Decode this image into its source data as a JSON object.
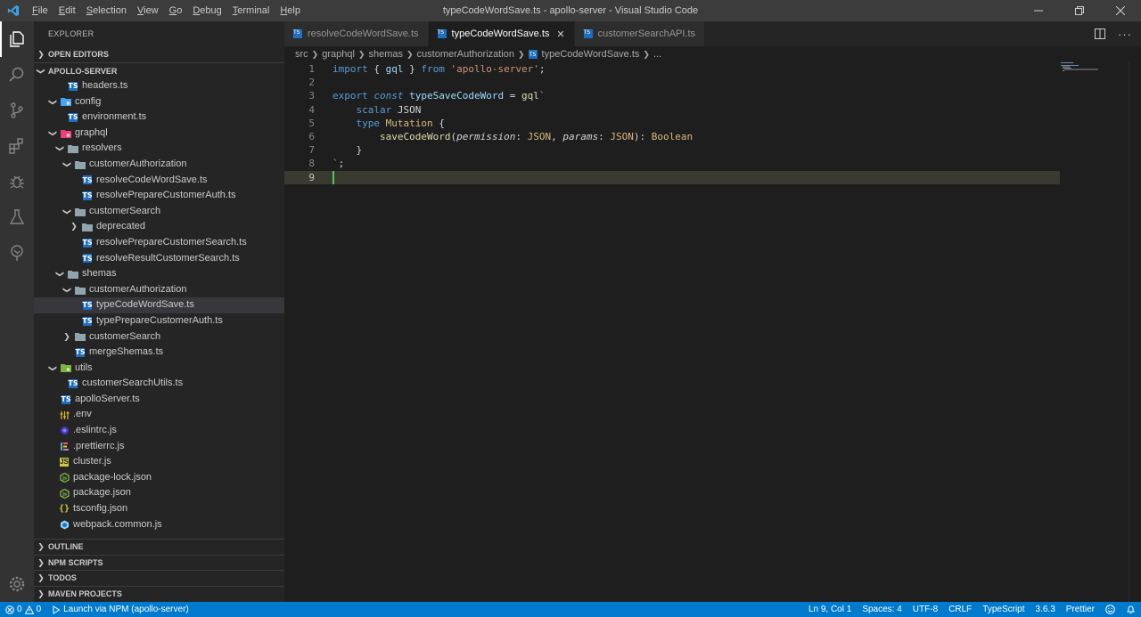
{
  "window": {
    "title": "typeCodeWordSave.ts - apollo-server - Visual Studio Code",
    "menu": [
      "File",
      "Edit",
      "Selection",
      "View",
      "Go",
      "Debug",
      "Terminal",
      "Help"
    ]
  },
  "sidebar": {
    "title": "EXPLORER",
    "sections_top": [
      "OPEN EDITORS",
      "APOLLO-SERVER"
    ],
    "tree": [
      {
        "label": "headers.ts",
        "depth": 2,
        "icon": "ts",
        "twisty": ""
      },
      {
        "label": "config",
        "depth": 1,
        "icon": "folder-config",
        "twisty": "open"
      },
      {
        "label": "environment.ts",
        "depth": 2,
        "icon": "ts",
        "twisty": ""
      },
      {
        "label": "graphql",
        "depth": 1,
        "icon": "folder-graphql",
        "twisty": "open"
      },
      {
        "label": "resolvers",
        "depth": 2,
        "icon": "folder",
        "twisty": "open"
      },
      {
        "label": "customerAuthorization",
        "depth": 3,
        "icon": "folder",
        "twisty": "open"
      },
      {
        "label": "resolveCodeWordSave.ts",
        "depth": 4,
        "icon": "ts",
        "twisty": ""
      },
      {
        "label": "resolvePrepareCustomerAuth.ts",
        "depth": 4,
        "icon": "ts",
        "twisty": ""
      },
      {
        "label": "customerSearch",
        "depth": 3,
        "icon": "folder",
        "twisty": "open"
      },
      {
        "label": "deprecated",
        "depth": 4,
        "icon": "folder",
        "twisty": "closed"
      },
      {
        "label": "resolvePrepareCustomerSearch.ts",
        "depth": 4,
        "icon": "ts",
        "twisty": ""
      },
      {
        "label": "resolveResultCustomerSearch.ts",
        "depth": 4,
        "icon": "ts",
        "twisty": ""
      },
      {
        "label": "shemas",
        "depth": 2,
        "icon": "folder",
        "twisty": "open"
      },
      {
        "label": "customerAuthorization",
        "depth": 3,
        "icon": "folder",
        "twisty": "open"
      },
      {
        "label": "typeCodeWordSave.ts",
        "depth": 4,
        "icon": "ts",
        "twisty": "",
        "selected": true
      },
      {
        "label": "typePrepareCustomerAuth.ts",
        "depth": 4,
        "icon": "ts",
        "twisty": ""
      },
      {
        "label": "customerSearch",
        "depth": 3,
        "icon": "folder",
        "twisty": "closed"
      },
      {
        "label": "mergeShemas.ts",
        "depth": 3,
        "icon": "ts",
        "twisty": ""
      },
      {
        "label": "utils",
        "depth": 1,
        "icon": "folder-utils",
        "twisty": "open"
      },
      {
        "label": "customerSearchUtils.ts",
        "depth": 2,
        "icon": "ts",
        "twisty": ""
      },
      {
        "label": "apolloServer.ts",
        "depth": 1,
        "icon": "ts",
        "twisty": ""
      },
      {
        "label": ".env",
        "depth": 0,
        "icon": "env",
        "twisty": ""
      },
      {
        "label": ".eslintrc.js",
        "depth": 0,
        "icon": "eslint",
        "twisty": ""
      },
      {
        "label": ".prettierrc.js",
        "depth": 0,
        "icon": "prettier",
        "twisty": ""
      },
      {
        "label": "cluster.js",
        "depth": 0,
        "icon": "js",
        "twisty": ""
      },
      {
        "label": "package-lock.json",
        "depth": 0,
        "icon": "npm",
        "twisty": ""
      },
      {
        "label": "package.json",
        "depth": 0,
        "icon": "npm",
        "twisty": ""
      },
      {
        "label": "tsconfig.json",
        "depth": 0,
        "icon": "json",
        "twisty": ""
      },
      {
        "label": "webpack.common.js",
        "depth": 0,
        "icon": "webpack",
        "twisty": ""
      }
    ],
    "sections_bottom": [
      "OUTLINE",
      "NPM SCRIPTS",
      "TODOS",
      "MAVEN PROJECTS"
    ]
  },
  "tabs": [
    {
      "label": "resolveCodeWordSave.ts",
      "active": false
    },
    {
      "label": "typeCodeWordSave.ts",
      "active": true
    },
    {
      "label": "customerSearchAPI.ts",
      "active": false
    }
  ],
  "breadcrumb": [
    "src",
    "graphql",
    "shemas",
    "customerAuthorization",
    "typeCodeWordSave.ts",
    "..."
  ],
  "editor": {
    "line_numbers": [
      "1",
      "2",
      "3",
      "4",
      "5",
      "6",
      "7",
      "8",
      "9"
    ],
    "current_line": 9
  },
  "statusbar": {
    "errors": "0",
    "warnings": "0",
    "launch": "Launch via NPM (apollo-server)",
    "position": "Ln 9, Col 1",
    "spaces": "Spaces: 4",
    "encoding": "UTF-8",
    "eol": "CRLF",
    "language": "TypeScript",
    "version": "3.6.3",
    "formatter": "Prettier"
  },
  "colors": {
    "accent": "#007acc",
    "activity_bar": "#333333",
    "sidebar": "#252526",
    "editor": "#1e1e1e",
    "selection": "#37373d"
  }
}
